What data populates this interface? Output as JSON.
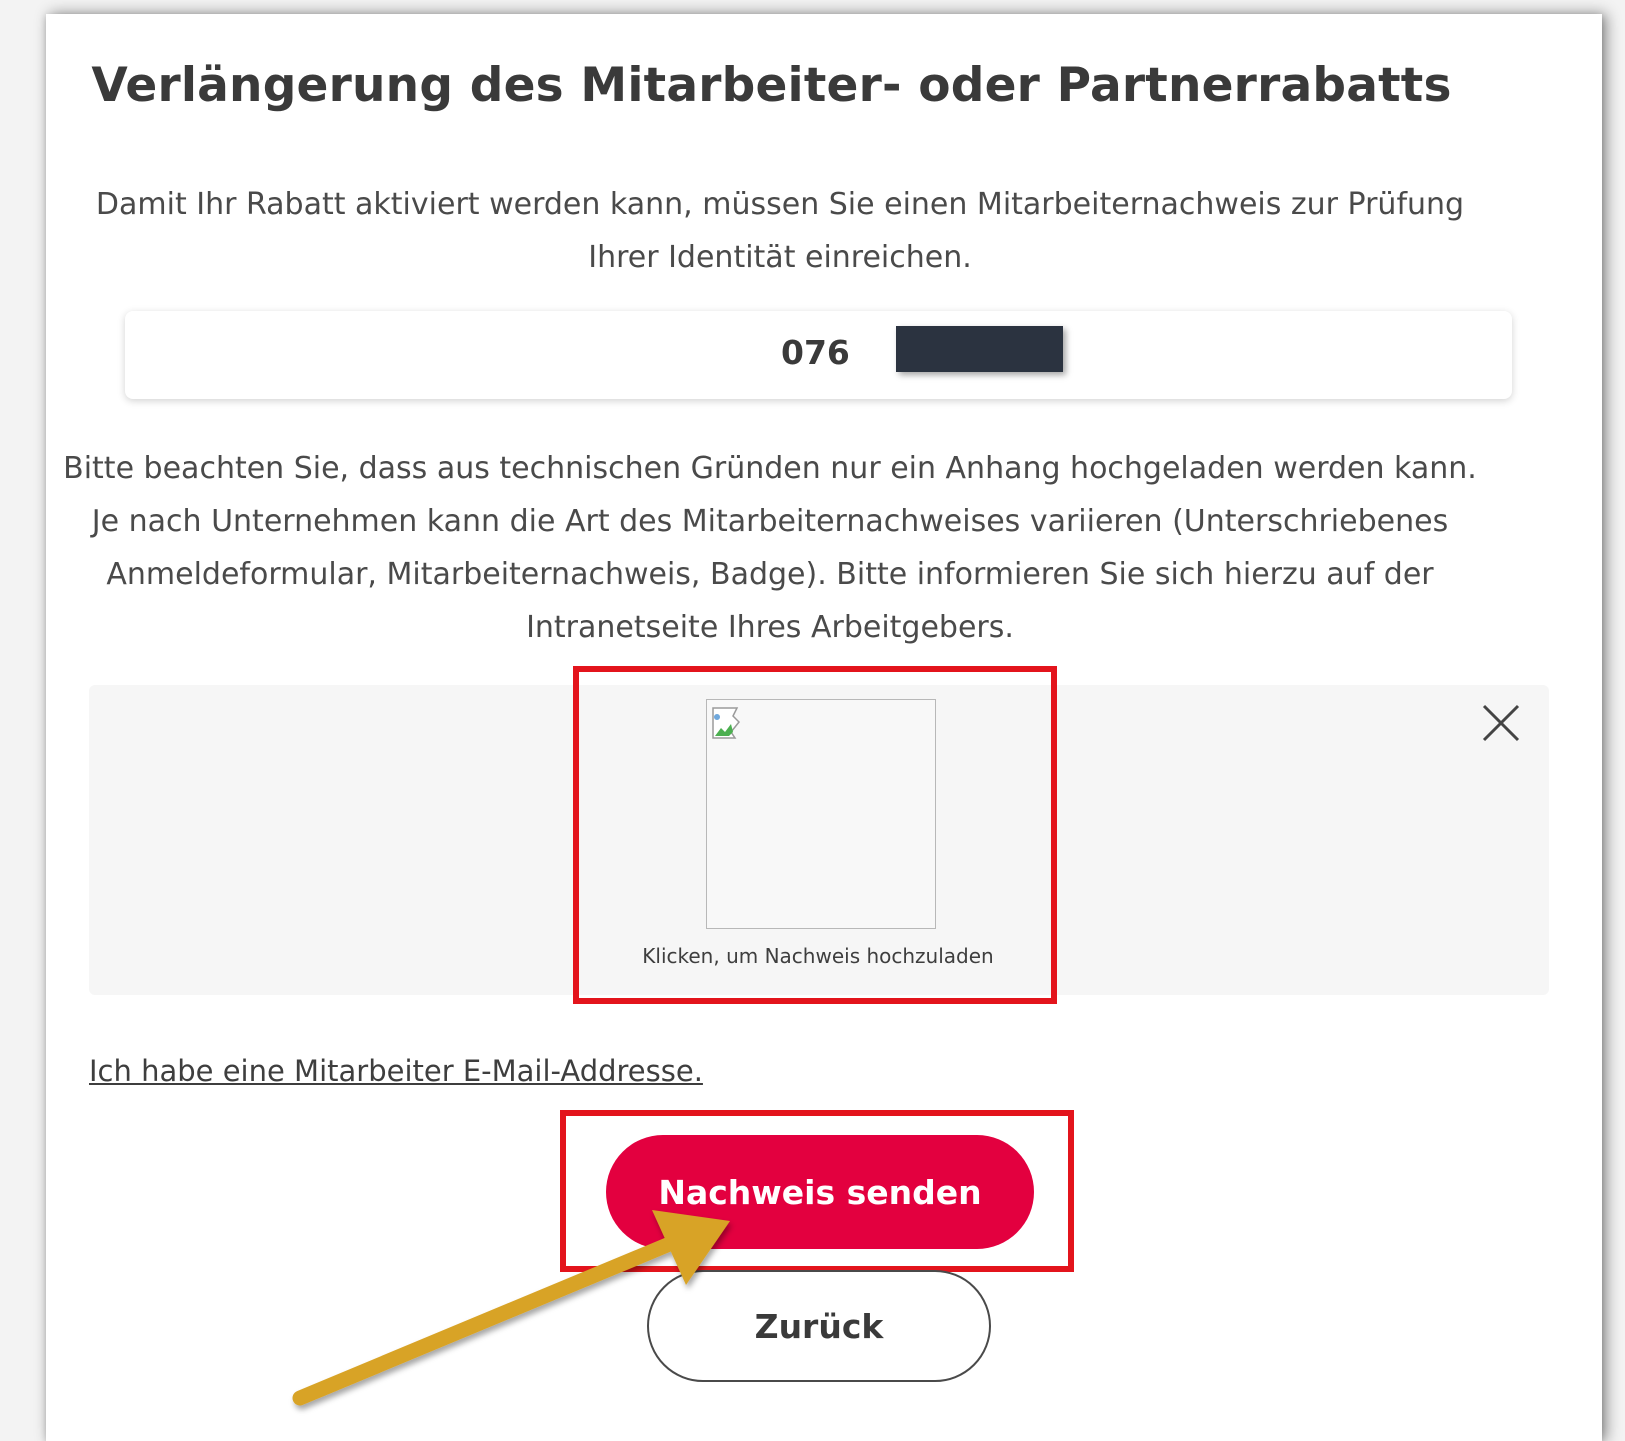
{
  "dialog": {
    "title": "Verlängerung des Mitarbeiter- oder Partnerrabatts",
    "intro": "Damit Ihr Rabatt aktiviert werden kann, müssen Sie einen Mitarbeiternachweis zur Prüfung Ihrer Identität einreichen.",
    "number_visible": "076",
    "info": "Bitte beachten Sie, dass aus technischen Gründen nur ein Anhang hochgeladen werden kann. Je nach Unternehmen kann die Art des Mitarbeiternachweises variieren (Unterschriebenes Anmeldeformular, Mitarbeiternachweis, Badge). Bitte informieren Sie sich hierzu auf der Intranetseite Ihres Arbeitgebers."
  },
  "upload": {
    "caption": "Klicken, um Nachweis hochzuladen",
    "close_icon": "close-icon",
    "image_icon": "broken-image-icon"
  },
  "links": {
    "employee_email": "Ich habe eine Mitarbeiter E-Mail-Addresse."
  },
  "buttons": {
    "send": "Nachweis senden",
    "back": "Zurück"
  },
  "colors": {
    "primary": "#e3003f",
    "highlight": "#e3141c",
    "arrow": "#d8a326",
    "redaction": "#2b3340"
  }
}
